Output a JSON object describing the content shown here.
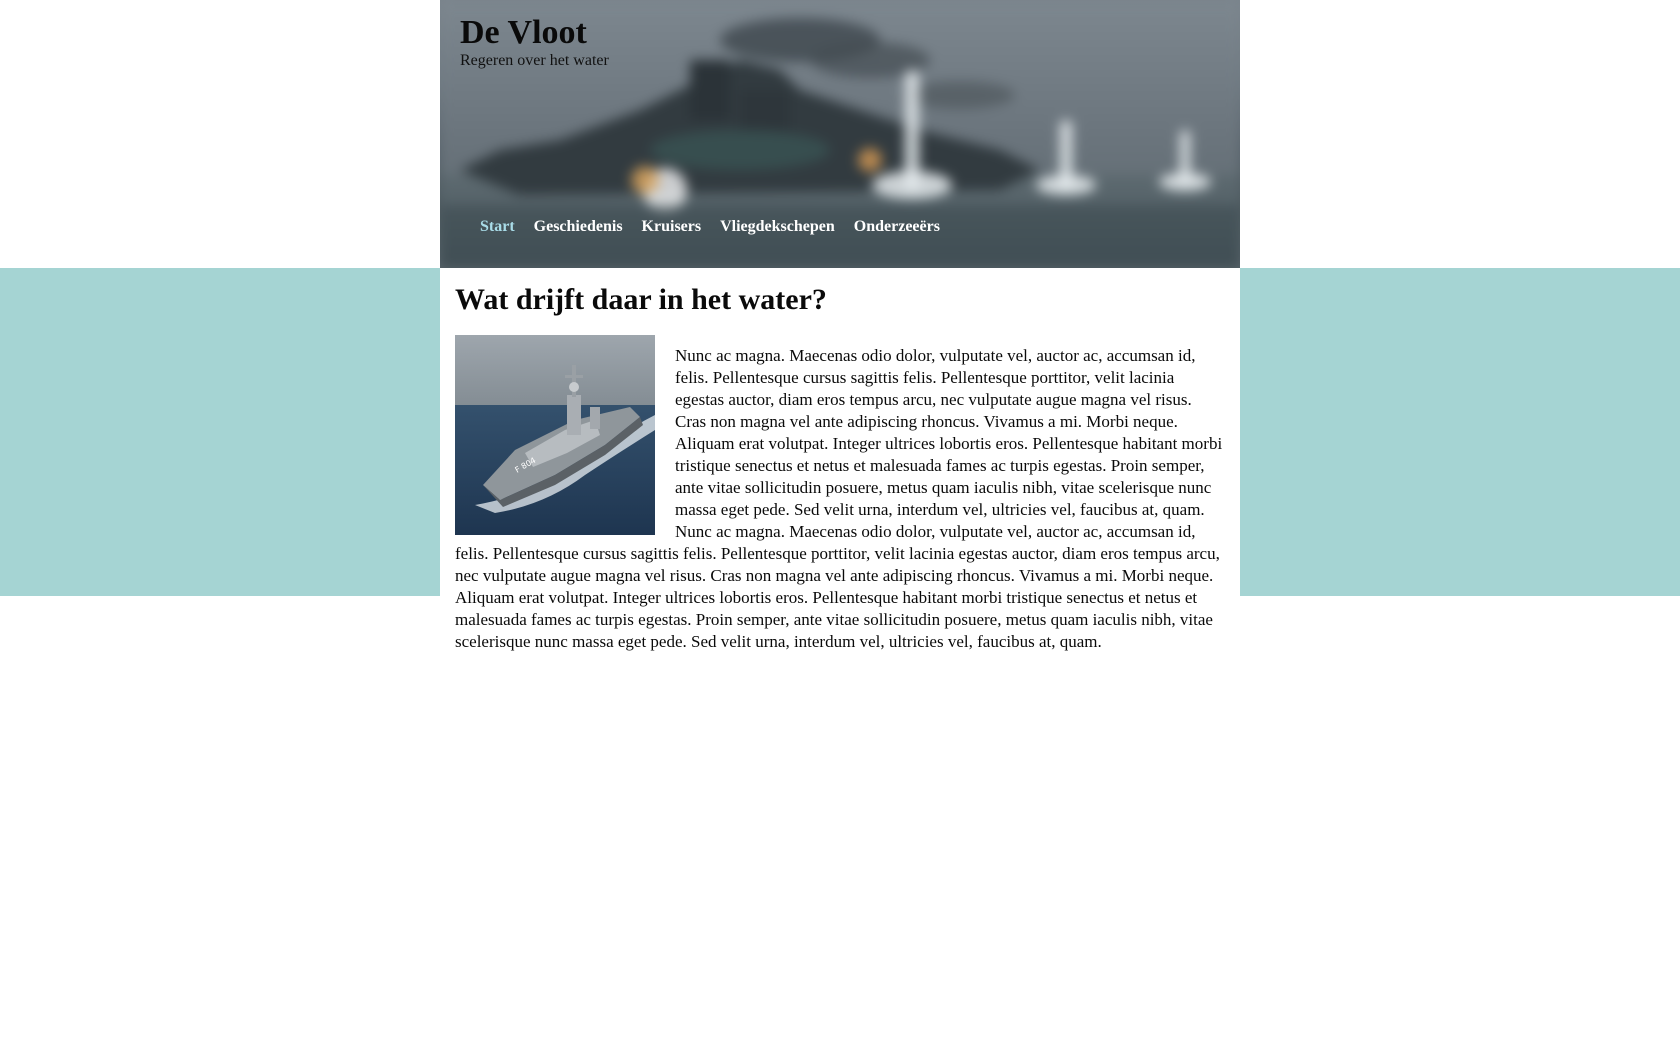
{
  "site": {
    "title": "De Vloot",
    "tagline": "Regeren over het water"
  },
  "nav": {
    "items": [
      {
        "label": "Start",
        "active": true
      },
      {
        "label": "Geschiedenis",
        "active": false
      },
      {
        "label": "Kruisers",
        "active": false
      },
      {
        "label": "Vliegdekschepen",
        "active": false
      },
      {
        "label": "Onderzeeërs",
        "active": false
      }
    ]
  },
  "main": {
    "heading": "Wat drijft daar in het water?",
    "body": "Nunc ac magna. Maecenas odio dolor, vulputate vel, auctor ac, accumsan id, felis. Pellentesque cursus sagittis felis. Pellentesque porttitor, velit lacinia egestas auctor, diam eros tempus arcu, nec vulputate augue magna vel risus. Cras non magna vel ante adipiscing rhoncus. Vivamus a mi. Morbi neque. Aliquam erat volutpat. Integer ultrices lobortis eros. Pellentesque habitant morbi tristique senectus et netus et malesuada fames ac turpis egestas. Proin semper, ante vitae sollicitudin posuere, metus quam iaculis nibh, vitae scelerisque nunc massa eget pede. Sed velit urna, interdum vel, ultricies vel, faucibus at, quam. Nunc ac magna. Maecenas odio dolor, vulputate vel, auctor ac, accumsan id, felis. Pellentesque cursus sagittis felis. Pellentesque porttitor, velit lacinia egestas auctor, diam eros tempus arcu, nec vulputate augue magna vel risus. Cras non magna vel ante adipiscing rhoncus. Vivamus a mi. Morbi neque. Aliquam erat volutpat. Integer ultrices lobortis eros. Pellentesque habitant morbi tristique senectus et netus et malesuada fames ac turpis egestas. Proin semper, ante vitae sollicitudin posuere, metus quam iaculis nibh, vitae scelerisque nunc massa eget pede. Sed velit urna, interdum vel, ultricies vel, faucibus at, quam."
  },
  "colors": {
    "band": "#a5d4d3",
    "nav_active": "#a9dce8",
    "nav_text": "#ffffff"
  }
}
